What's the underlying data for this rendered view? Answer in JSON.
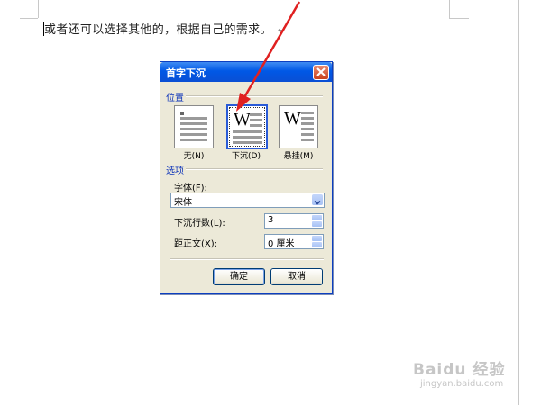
{
  "document": {
    "text": "或者还可以选择其他的，根据自己的需求。",
    "paragraph_mark": "↵"
  },
  "dialog": {
    "title": "首字下沉",
    "close_glyph": "✕",
    "position_group_label": "位置",
    "options": [
      {
        "label": "无(N)",
        "glyph": ""
      },
      {
        "label": "下沉(D)",
        "glyph": "W"
      },
      {
        "label": "悬挂(M)",
        "glyph": "W"
      }
    ],
    "selected_option": "下沉(D)",
    "options_group_label": "选项",
    "font_label": "字体(F):",
    "font_value": "宋体",
    "lines_label": "下沉行数(L):",
    "lines_value": "3",
    "distance_label": "距正文(X):",
    "distance_value": "0 厘米",
    "ok_label": "确定",
    "cancel_label": "取消"
  },
  "watermark": {
    "main": "Baidu 经验",
    "sub": "jingyan.baidu.com"
  },
  "colors": {
    "titlebar": "#0058e6",
    "annotation_arrow": "#e02020",
    "dialog_bg": "#ece9d8"
  }
}
